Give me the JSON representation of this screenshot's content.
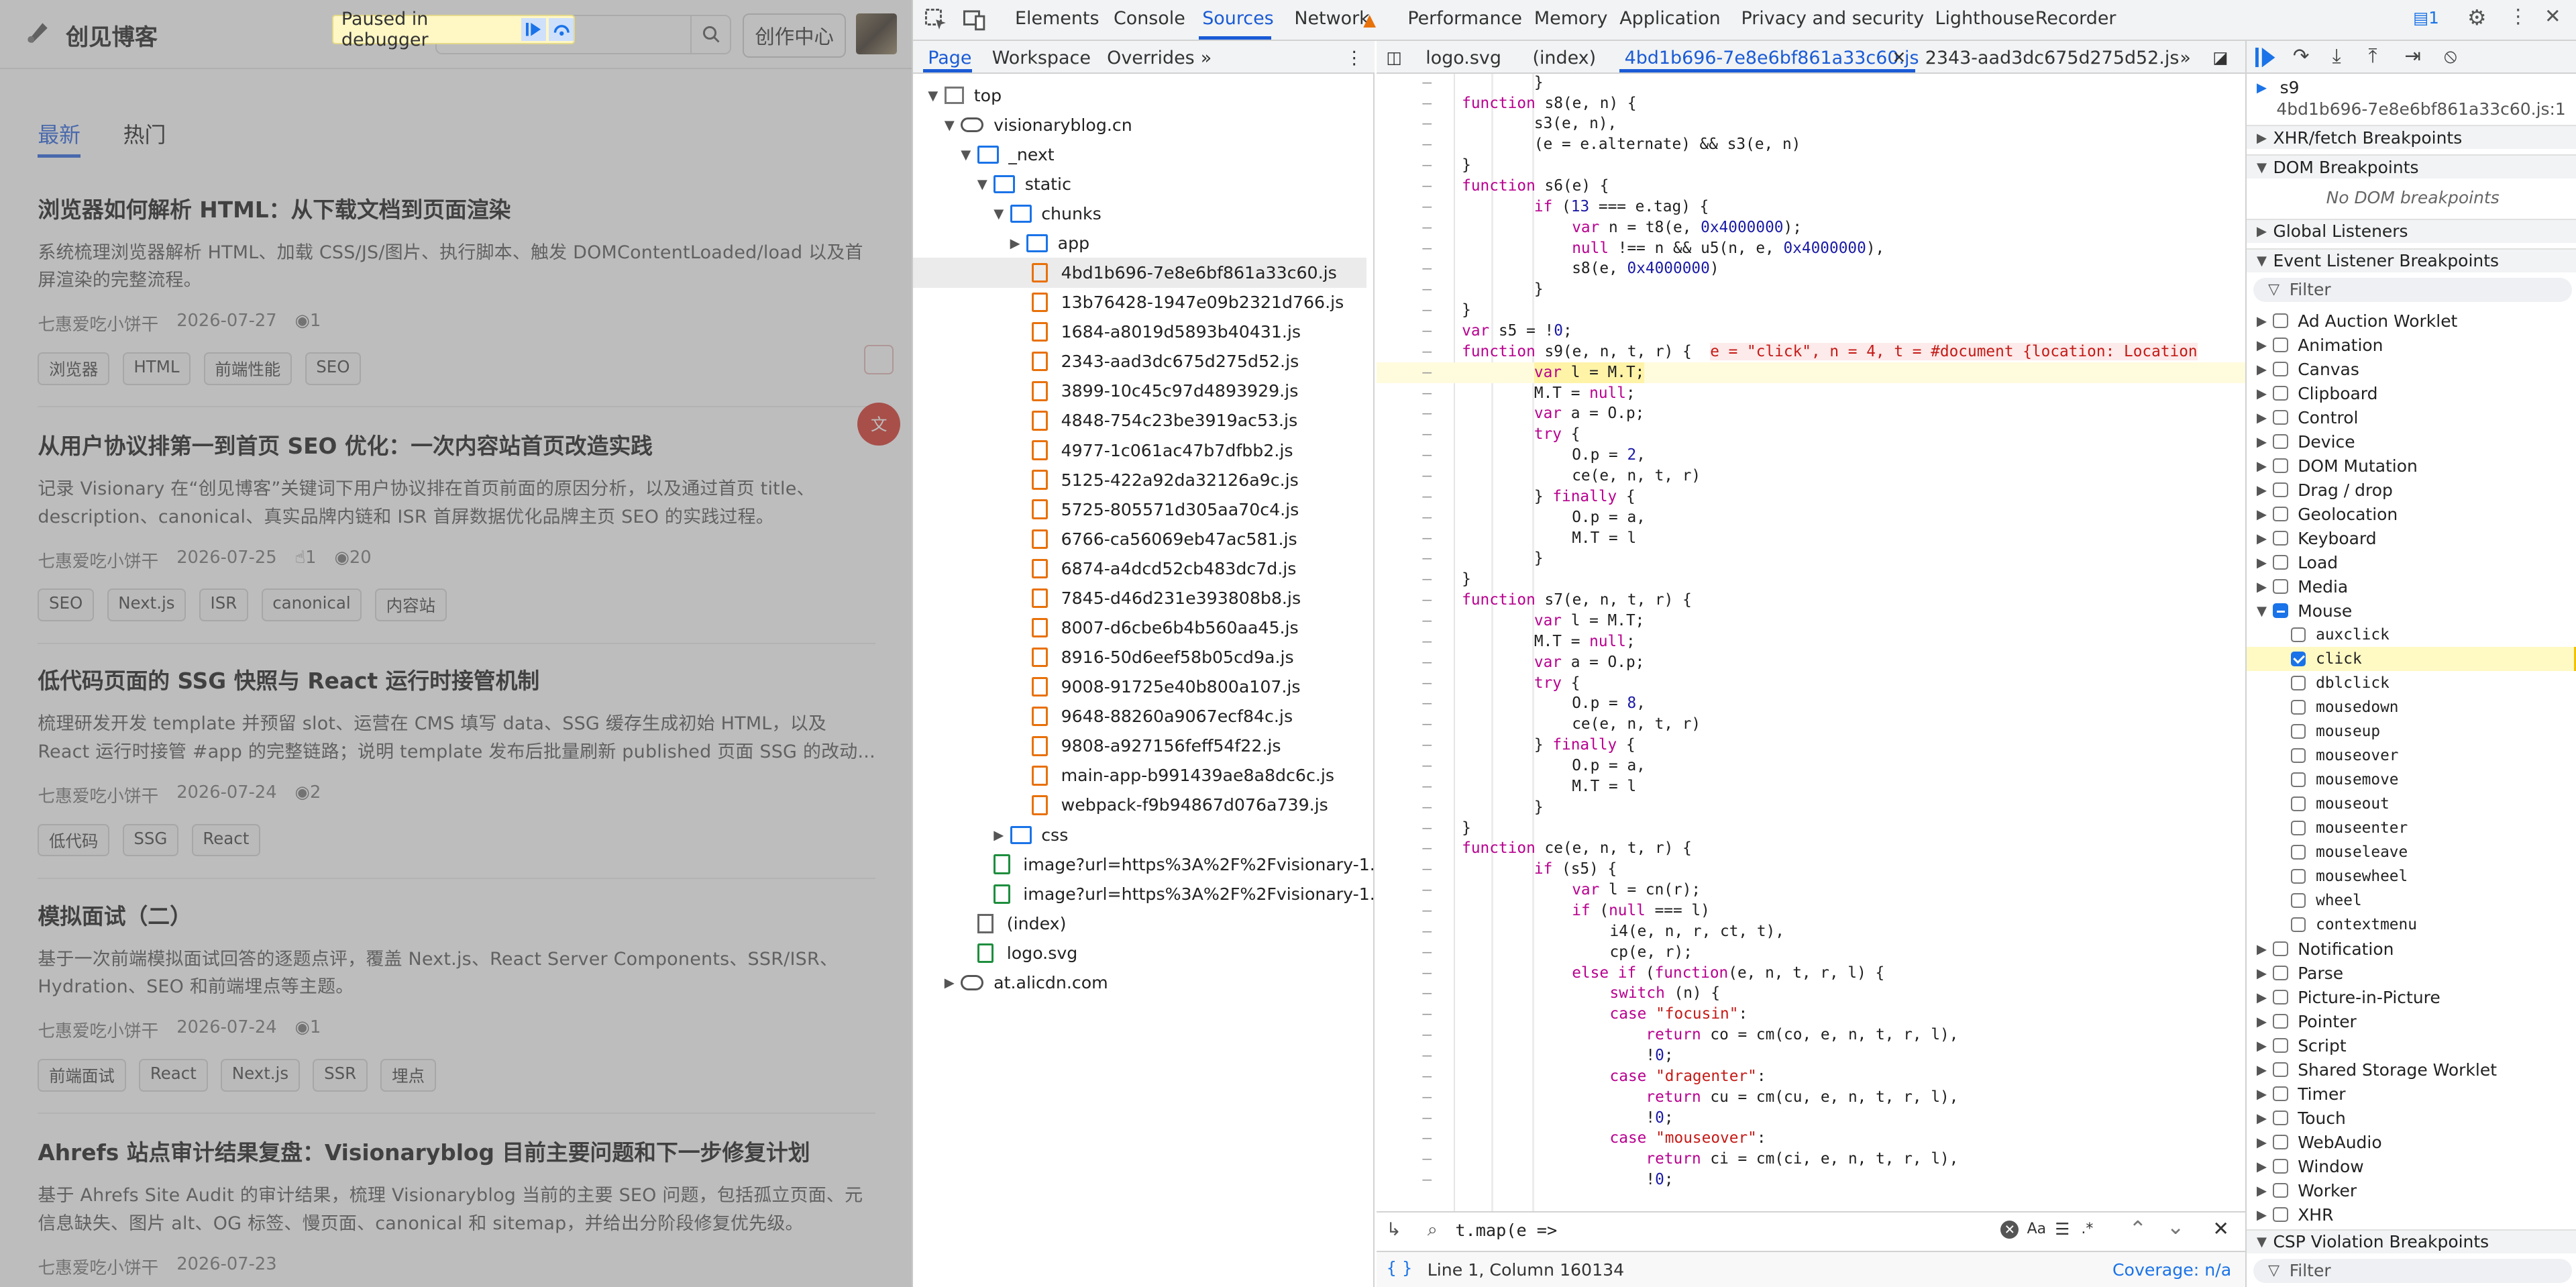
{
  "blog": {
    "site_name": "创见博客",
    "paused_label": "Paused in debugger",
    "create_button": "创作中心",
    "tabs": [
      "最新",
      "热门"
    ],
    "articles": [
      {
        "title": "浏览器如何解析 HTML：从下载文档到页面渲染",
        "desc": "系统梳理浏览器解析 HTML、加载 CSS/JS/图片、执行脚本、触发 DOMContentLoaded/load 以及首屏渲染的完整流程。",
        "author": "七惠爱吃小饼干",
        "date": "2026-07-27",
        "likes": "",
        "views": "1",
        "tags": [
          "浏览器",
          "HTML",
          "前端性能",
          "SEO"
        ]
      },
      {
        "title": "从用户协议排第一到首页 SEO 优化：一次内容站首页改造实践",
        "desc": "记录 Visionary 在“创见博客”关键词下用户协议排在首页前面的原因分析，以及通过首页 title、description、canonical、真实品牌内链和 ISR 首屏数据优化品牌主页 SEO 的实践过程。",
        "author": "七惠爱吃小饼干",
        "date": "2026-07-25",
        "likes": "1",
        "views": "20",
        "tags": [
          "SEO",
          "Next.js",
          "ISR",
          "canonical",
          "内容站"
        ]
      },
      {
        "title": "低代码页面的 SSG 快照与 React 运行时接管机制",
        "desc": "梳理研发开发 template 并预留 slot、运营在 CMS 填写 data、SSG 缓存生成初始 HTML，以及 React 运行时接管 #app 的完整链路；说明 template 发布后批量刷新 published 页面 SSG 的改动...",
        "author": "七惠爱吃小饼干",
        "date": "2026-07-24",
        "likes": "",
        "views": "2",
        "tags": [
          "低代码",
          "SSG",
          "React"
        ]
      },
      {
        "title": "模拟面试（二）",
        "desc": "基于一次前端模拟面试回答的逐题点评，覆盖 Next.js、React Server Components、SSR/ISR、Hydration、SEO 和前端埋点等主题。",
        "author": "七惠爱吃小饼干",
        "date": "2026-07-24",
        "likes": "",
        "views": "1",
        "tags": [
          "前端面试",
          "React",
          "Next.js",
          "SSR",
          "埋点"
        ]
      },
      {
        "title": "Ahrefs 站点审计结果复盘：Visionaryblog 目前主要问题和下一步修复计划",
        "desc": "基于 Ahrefs Site Audit 的审计结果，梳理 Visionaryblog 当前的主要 SEO 问题，包括孤立页面、元信息缺失、图片 alt、OG 标签、慢页面、canonical 和 sitemap，并给出分阶段修复优先级。",
        "author": "七惠爱吃小饼干",
        "date": "2026-07-23",
        "likes": "",
        "views": "",
        "tags": []
      }
    ]
  },
  "devtools": {
    "main_tabs": [
      "Elements",
      "Console",
      "Sources",
      "Network",
      "Performance",
      "Memory",
      "Application",
      "Privacy and security",
      "Lighthouse",
      "Recorder"
    ],
    "active_main_tab": "Sources",
    "issues_count": "1",
    "nav_tabs": [
      "Page",
      "Workspace",
      "Overrides"
    ],
    "file_tabs": [
      "logo.svg",
      "(index)",
      "4bd1b696-7e8e6bf861a33c60.js",
      "2343-aad3dc675d275d52.js"
    ],
    "tree": {
      "top": "top",
      "domain": "visionaryblog.cn",
      "next": "_next",
      "static": "static",
      "chunks": "chunks",
      "app": "app",
      "files": [
        "4bd1b696-7e8e6bf861a33c60.js",
        "13b76428-1947e09b2321d766.js",
        "1684-a8019d5893b40431.js",
        "2343-aad3dc675d275d52.js",
        "3899-10c45c97d4893929.js",
        "4848-754c23be3919ac53.js",
        "4977-1c061ac47b7dfbb2.js",
        "5125-422a92da32126a9c.js",
        "5725-805571d305aa70c4.js",
        "6766-ca56069eb47ac581.js",
        "6874-a4dcd52cb483dc7d.js",
        "7845-d46d231e393808b8.js",
        "8007-d6cbe6b4b560aa45.js",
        "8916-50d6eef58b05cd9a.js",
        "9008-91725e40b800a107.js",
        "9648-88260a9067ecf84c.js",
        "9808-a927156feff54f22.js",
        "main-app-b991439ae8a8dc6c.js",
        "webpack-f9b94867d076a739.js"
      ],
      "css": "css",
      "images": [
        "image?url=https%3A%2F%2Fvisionary-1...",
        "image?url=https%3A%2F%2Fvisionary-1..."
      ],
      "index": "(index)",
      "logo": "logo.svg",
      "cdn": "at.alicdn.com"
    },
    "search_query": "t.map(e =>",
    "search_options": [
      "Aa",
      ".*"
    ],
    "status_position": "Line 1, Column 160134",
    "coverage": "Coverage: n/a",
    "scope_name": "s9",
    "scope_file": "4bd1b696-7e8e6bf861a33c60.js:1",
    "sections": [
      "XHR/fetch Breakpoints",
      "DOM Breakpoints",
      "Global Listeners",
      "Event Listener Breakpoints",
      "CSP Violation Breakpoints"
    ],
    "no_dom": "No DOM breakpoints",
    "filter_placeholder": "Filter",
    "categories_top": [
      "Ad Auction Worklet",
      "Animation",
      "Canvas",
      "Clipboard",
      "Control",
      "Device",
      "DOM Mutation",
      "Drag / drop",
      "Geolocation",
      "Keyboard",
      "Load",
      "Media"
    ],
    "mouse_label": "Mouse",
    "mouse_events": [
      "auxclick",
      "click",
      "dblclick",
      "mousedown",
      "mouseup",
      "mouseover",
      "mousemove",
      "mouseout",
      "mouseenter",
      "mouseleave",
      "mousewheel",
      "wheel",
      "contextmenu"
    ],
    "categories_bottom": [
      "Notification",
      "Parse",
      "Picture-in-Picture",
      "Pointer",
      "Script",
      "Shared Storage Worklet",
      "Timer",
      "Touch",
      "WebAudio",
      "Window",
      "Worker",
      "XHR"
    ]
  }
}
